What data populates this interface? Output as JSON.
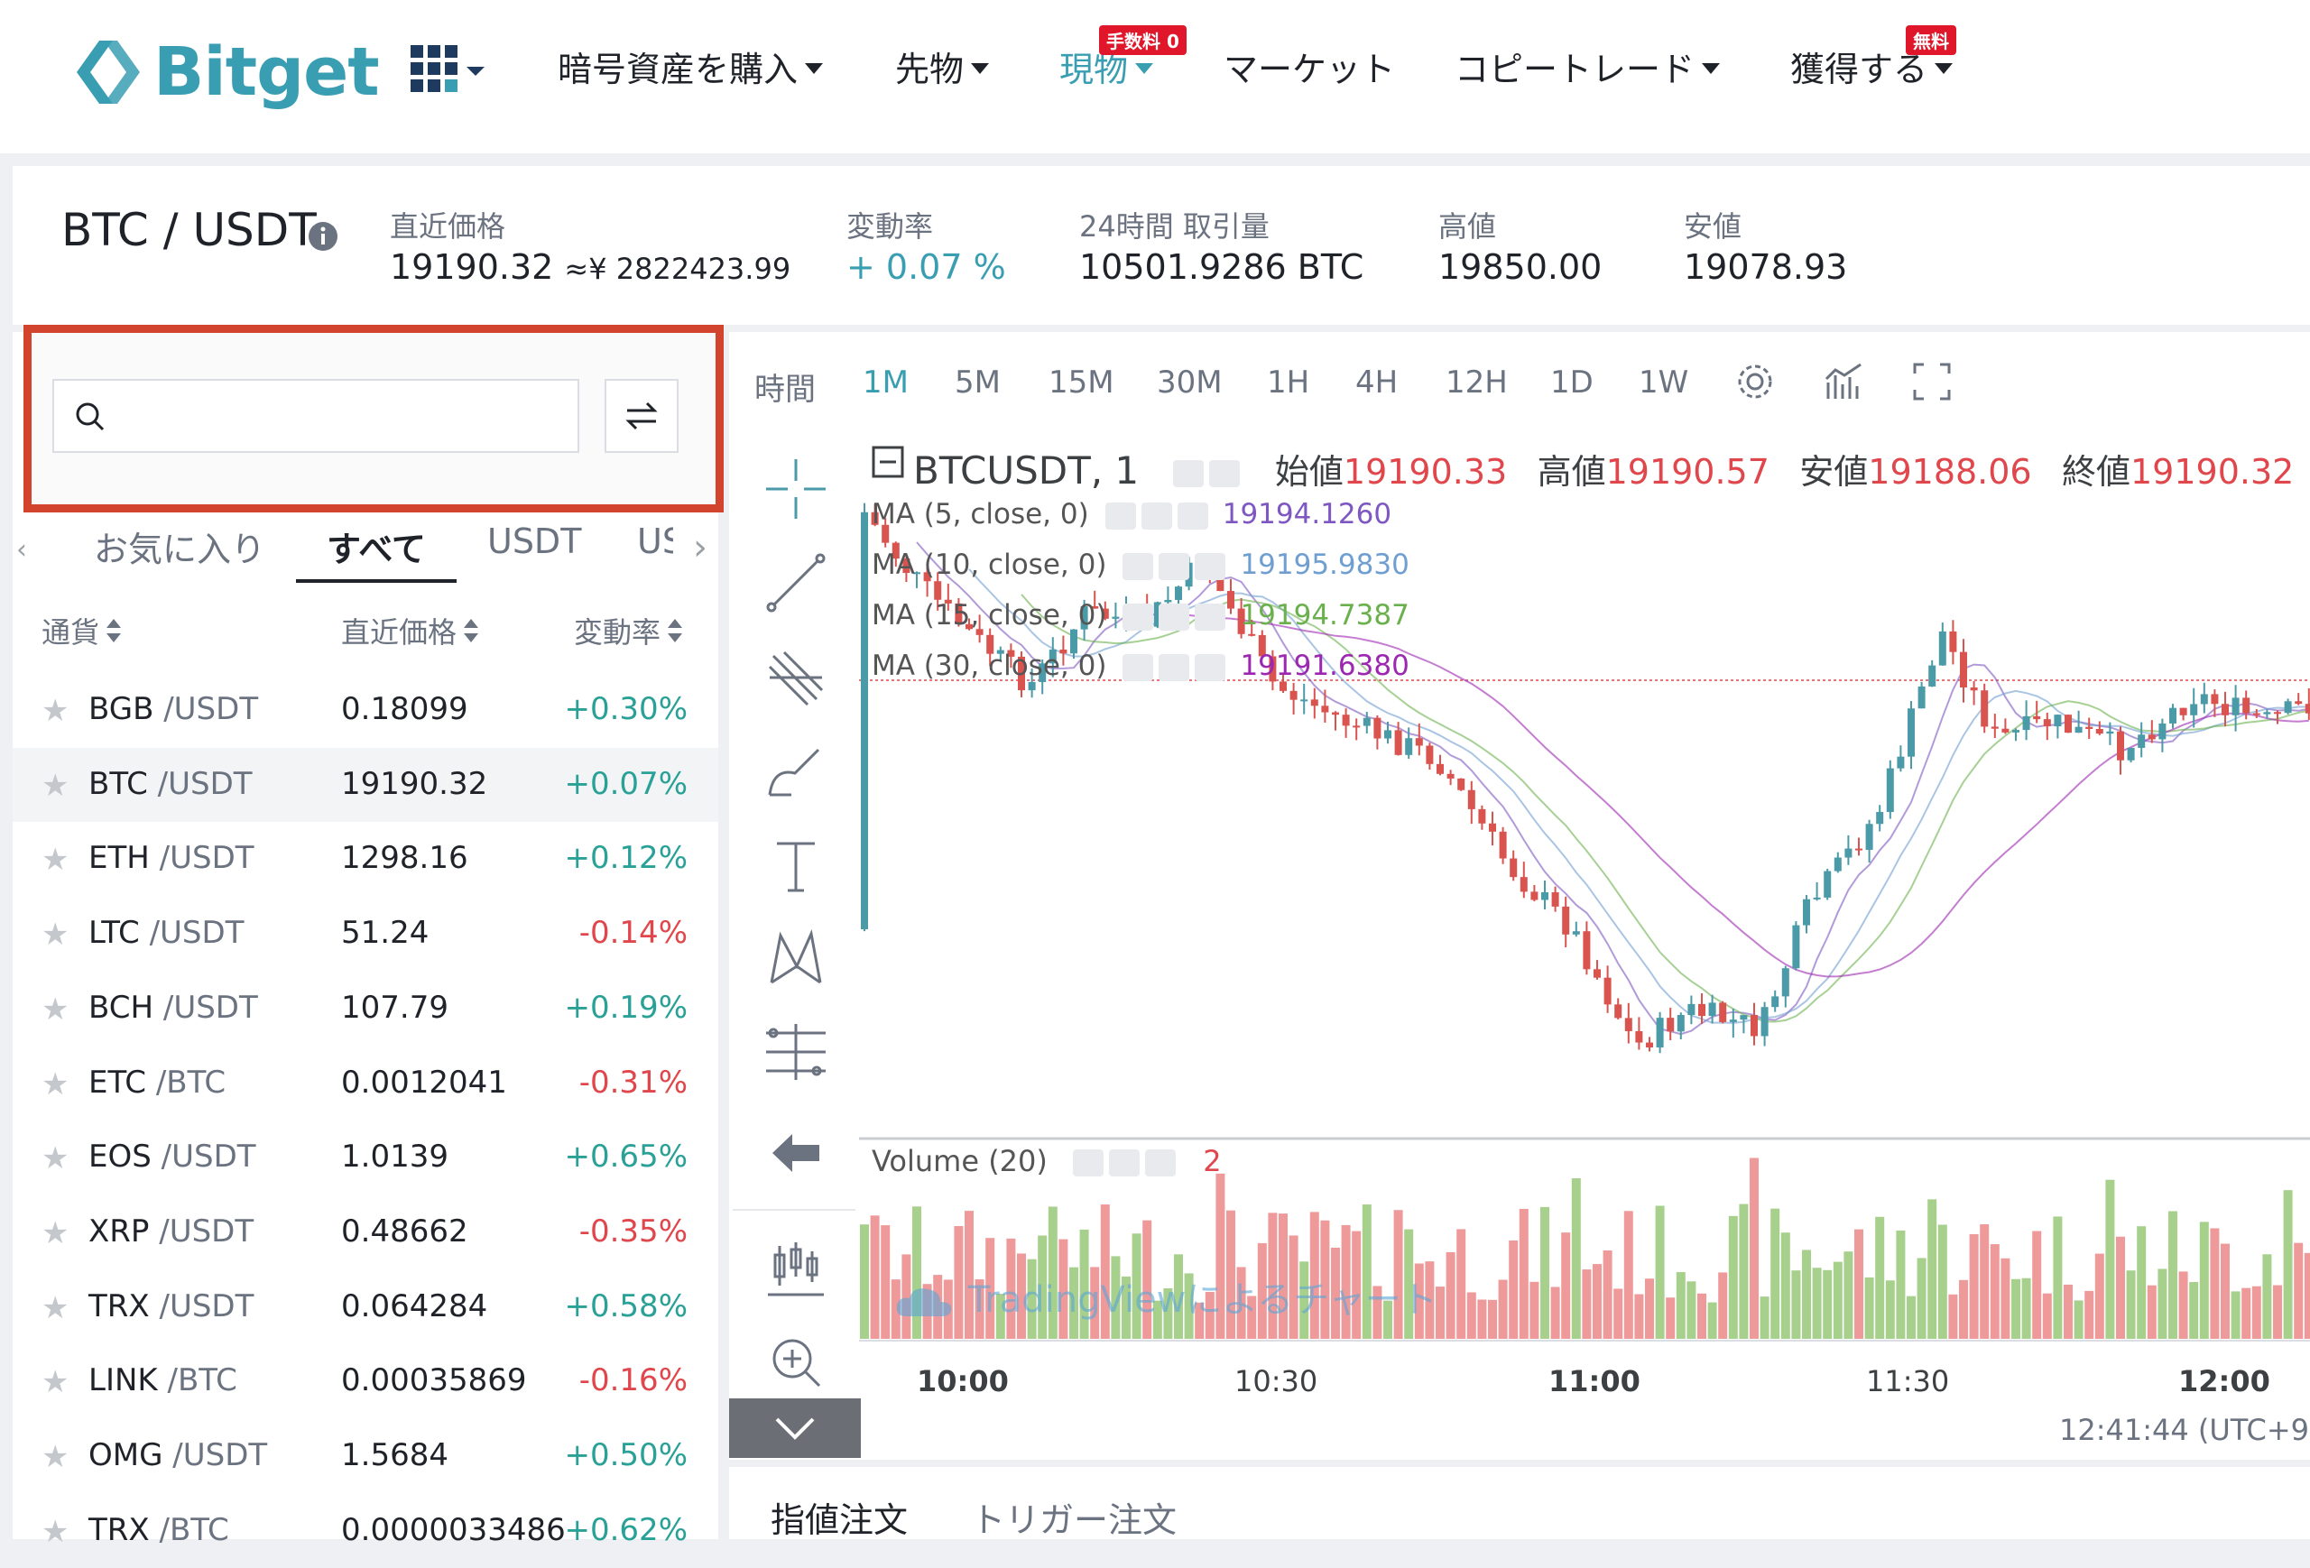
{
  "nav": {
    "logo": "Bitget",
    "items": [
      {
        "label": "暗号資産を購入",
        "caret": true,
        "badge": ""
      },
      {
        "label": "先物",
        "caret": true,
        "badge": ""
      },
      {
        "label": "現物",
        "caret": true,
        "badge": "手数料 0",
        "active": true
      },
      {
        "label": "マーケット",
        "caret": false,
        "badge": ""
      },
      {
        "label": "コピートレード",
        "caret": true,
        "badge": ""
      },
      {
        "label": "獲得する",
        "caret": true,
        "badge": "無料"
      }
    ]
  },
  "ticker": {
    "pair": "BTC / USDT",
    "last_label": "直近価格",
    "last_value": "19190.32",
    "last_fiat": "≈¥ 2822423.99",
    "change_label": "変動率",
    "change_value": "+ 0.07 %",
    "volume_label": "24時間 取引量",
    "volume_value": "10501.9286 BTC",
    "high_label": "高値",
    "high_value": "19850.00",
    "low_label": "安値",
    "low_value": "19078.93"
  },
  "market": {
    "search_placeholder": "",
    "tabs": [
      "お気に入り",
      "すべて",
      "USDT",
      "US"
    ],
    "active_tab": 1,
    "columns": [
      "通貨",
      "直近価格",
      "変動率"
    ],
    "rows": [
      {
        "base": "BGB",
        "quote": "/USDT",
        "price": "0.18099",
        "change": "+0.30%",
        "dir": "up"
      },
      {
        "base": "BTC",
        "quote": "/USDT",
        "price": "19190.32",
        "change": "+0.07%",
        "dir": "up",
        "selected": true
      },
      {
        "base": "ETH",
        "quote": "/USDT",
        "price": "1298.16",
        "change": "+0.12%",
        "dir": "up"
      },
      {
        "base": "LTC",
        "quote": "/USDT",
        "price": "51.24",
        "change": "-0.14%",
        "dir": "down"
      },
      {
        "base": "BCH",
        "quote": "/USDT",
        "price": "107.79",
        "change": "+0.19%",
        "dir": "up"
      },
      {
        "base": "ETC",
        "quote": "/BTC",
        "price": "0.0012041",
        "change": "-0.31%",
        "dir": "down"
      },
      {
        "base": "EOS",
        "quote": "/USDT",
        "price": "1.0139",
        "change": "+0.65%",
        "dir": "up"
      },
      {
        "base": "XRP",
        "quote": "/USDT",
        "price": "0.48662",
        "change": "-0.35%",
        "dir": "down"
      },
      {
        "base": "TRX",
        "quote": "/USDT",
        "price": "0.064284",
        "change": "+0.58%",
        "dir": "up"
      },
      {
        "base": "LINK",
        "quote": "/BTC",
        "price": "0.00035869",
        "change": "-0.16%",
        "dir": "down"
      },
      {
        "base": "OMG",
        "quote": "/USDT",
        "price": "1.5684",
        "change": "+0.50%",
        "dir": "up"
      },
      {
        "base": "TRX",
        "quote": "/BTC",
        "price": "0.0000033486",
        "change": "+0.62%",
        "dir": "up"
      }
    ]
  },
  "chart": {
    "time_label": "時間",
    "timeframes": [
      "1M",
      "5M",
      "15M",
      "30M",
      "1H",
      "4H",
      "12H",
      "1D",
      "1W"
    ],
    "active_tf": 0,
    "symbol": "BTCUSDT, 1",
    "ohlc": [
      {
        "label": "始値",
        "value": "19190.33"
      },
      {
        "label": "高値",
        "value": "19190.57"
      },
      {
        "label": "安値",
        "value": "19188.06"
      },
      {
        "label": "終値",
        "value": "19190.32"
      }
    ],
    "ma": [
      {
        "label": "MA (5, close, 0)",
        "value": "19194.1260",
        "color": "#7e57c2"
      },
      {
        "label": "MA (10, close, 0)",
        "value": "19195.9830",
        "color": "#6f9fd0"
      },
      {
        "label": "MA (15, close, 0)",
        "value": "19194.7387",
        "color": "#6ab04c"
      },
      {
        "label": "MA (30, close, 0)",
        "value": "19191.6380",
        "color": "#9c27b0"
      }
    ],
    "volume_label": "Volume (20)",
    "volume_value": "2",
    "watermark": "TradingViewによるチャート",
    "time_ticks": [
      "10:00",
      "10:30",
      "11:00",
      "11:30",
      "12:00"
    ],
    "clock": "12:41:44 (UTC+9)",
    "colors": {
      "up": "#4a9aa8",
      "down": "#d9534f",
      "vol_up": "#a8d08d",
      "vol_down": "#ef9a9a"
    }
  },
  "orders": {
    "tabs": [
      "指値注文",
      "トリガー注文"
    ]
  }
}
